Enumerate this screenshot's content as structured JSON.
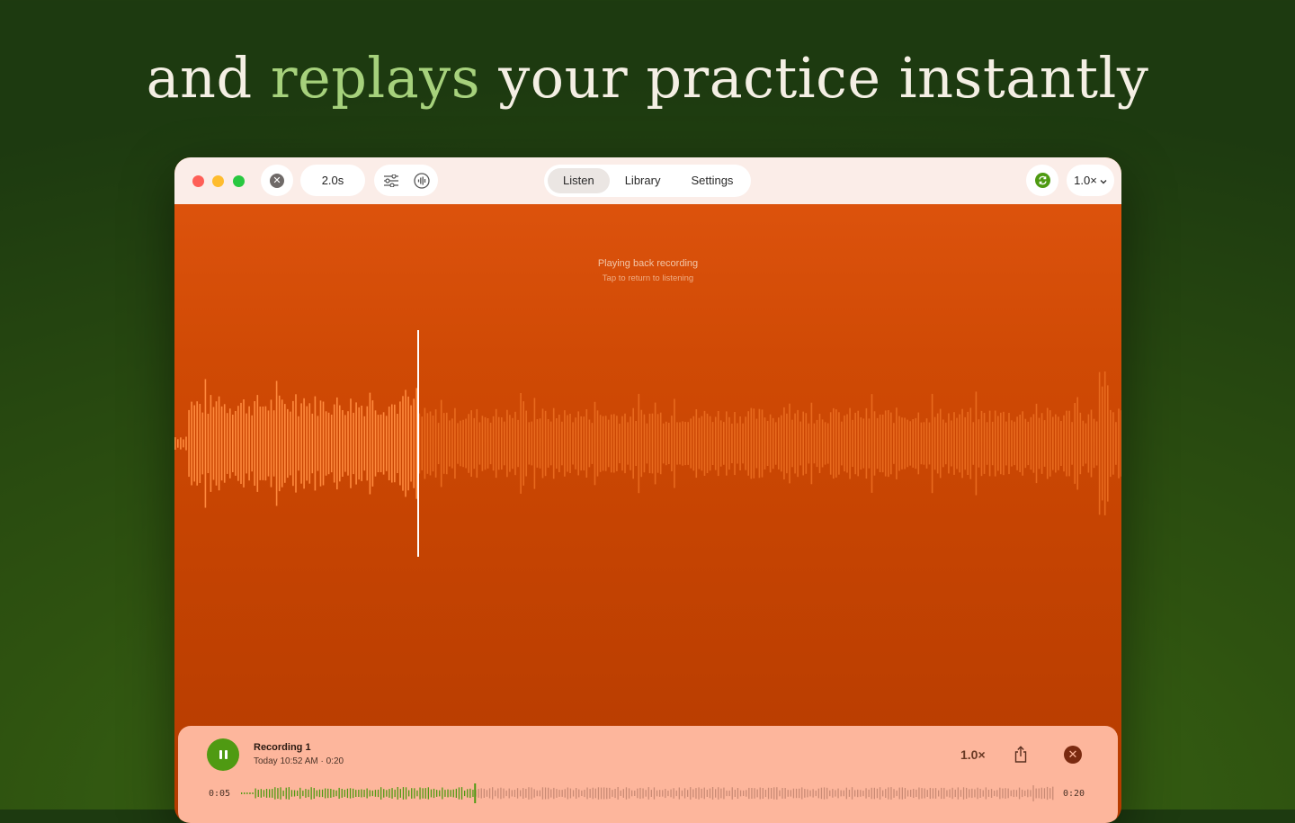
{
  "headline": {
    "before": "and ",
    "accent": "replays",
    "after": " your practice instantly"
  },
  "toolbar": {
    "delay": "2.0s",
    "tabs": [
      {
        "label": "Listen",
        "active": true
      },
      {
        "label": "Library",
        "active": false
      },
      {
        "label": "Settings",
        "active": false
      }
    ],
    "speed": "1.0×"
  },
  "status": {
    "title": "Playing back recording",
    "hint": "Tap to return to listening"
  },
  "player": {
    "title": "Recording 1",
    "meta": "Today 10:52 AM · 0:20",
    "speed": "1.0×",
    "elapsed": "0:05",
    "duration": "0:20",
    "progress": 0.25
  },
  "colors": {
    "accent_green": "#4f9a12",
    "headline_accent": "#a6d17c",
    "waveform_played": "#ff8a3d",
    "waveform_unplayed": "#e86a1e"
  },
  "icons": {
    "close": "close-circle-icon",
    "sliders": "sliders-icon",
    "waveform": "waveform-circle-icon",
    "loop": "loop-icon",
    "chevron": "chevron-down-icon",
    "pause": "pause-icon",
    "share": "share-icon"
  }
}
